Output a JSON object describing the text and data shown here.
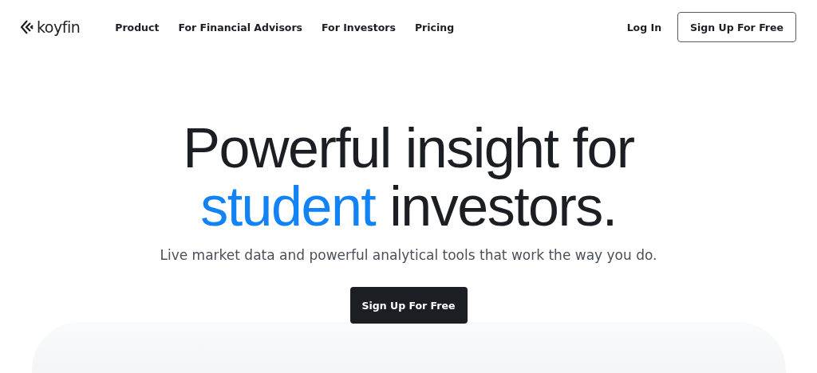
{
  "nav": {
    "logo": "koyfin",
    "links": [
      "Product",
      "For Financial Advisors",
      "For Investors",
      "Pricing"
    ],
    "login": "Log In",
    "signup": "Sign Up For Free"
  },
  "hero": {
    "headline_line_1": "Powerful insight for",
    "headline_line_2": [
      {
        "text": "student",
        "highlight": true
      },
      {
        "text": "investors.",
        "highlight": false
      }
    ],
    "subtitle": "Live market data and powerful analytical tools that work the way you do.",
    "cta": "Sign Up For Free"
  }
}
